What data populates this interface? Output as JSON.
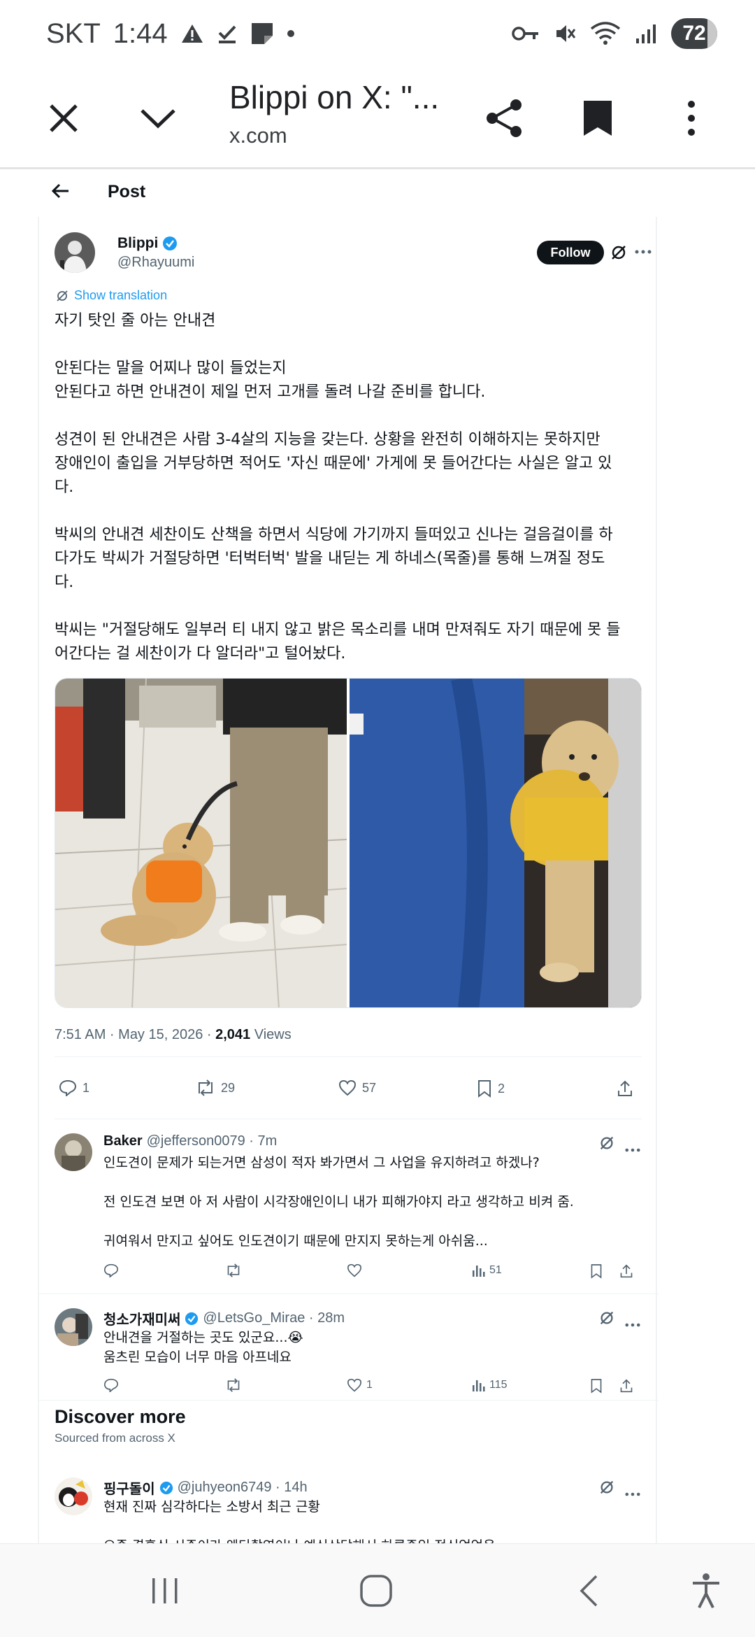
{
  "status_bar": {
    "carrier": "SKT",
    "time": "1:44",
    "battery": "72"
  },
  "tab_header": {
    "title": "Blippi on X: \"...",
    "url": "x.com"
  },
  "post_nav": {
    "title": "Post"
  },
  "post": {
    "author_name": "Blippi",
    "author_handle": "@Rhayuumi",
    "follow_label": "Follow",
    "translate_label": "Show translation",
    "paragraphs": {
      "p1": "자기 탓인 줄 아는 안내견",
      "p2a": "안된다는 말을 어찌나 많이 들었는지",
      "p2b": "안된다고 하면 안내견이 제일 먼저 고개를 돌려 나갈 준비를 합니다.",
      "p3a": "성견이 된 안내견은 사람 3-4살의 지능을 갖는다. 상황을 완전히 이해하지는 못하지만",
      "p3b": "장애인이 출입을 거부당하면 적어도 '자신 때문에' 가게에 못 들어간다는 사실은 알고 있",
      "p3c": "다.",
      "p4a": "박씨의 안내견 세찬이도 산책을 하면서 식당에 가기까지 들떠있고 신나는 걸음걸이를 하",
      "p4b": "다가도 박씨가 거절당하면 '터벅터벅' 발을 내딛는 게 하네스(목줄)를 통해 느껴질 정도",
      "p4c": "다.",
      "p5a": "박씨는 \"거절당해도 일부러 티 내지 않고 밝은 목소리를 내며 만져줘도 자기 때문에 못 들",
      "p5b": "어간다는 걸 세찬이가 다 알더라\"고 털어놨다."
    },
    "time": "7:51 AM · May 15, 2026 · ",
    "views_count": "2,041",
    "views_label": " Views",
    "replies": "1",
    "reposts": "29",
    "likes": "57",
    "bookmarks": "2"
  },
  "replies": [
    {
      "name": "Baker",
      "handle": "@jefferson0079 · 7m",
      "line1": "인도견이 문제가 되는거면 삼성이 적자 봐가면서 그 사업을 유지하려고 하겠나?",
      "line2": "전 인도견 보면 아 저 사람이 시각장애인이니 내가 피해가야지 라고 생각하고 비켜 줌.",
      "line3": "귀여워서 만지고 싶어도 인도견이기 때문에 만지지 못하는게 아쉬움...",
      "views": "51",
      "likes": ""
    },
    {
      "name": "청소가재미써",
      "handle": "@LetsGo_Mirae · 28m",
      "line1": "안내견을 거절하는 곳도 있군요...😭",
      "line2": "움츠린 모습이 너무 마음 아프네요",
      "views": "115",
      "likes": "1"
    }
  ],
  "discover": {
    "title": "Discover more",
    "subtitle": "Sourced from across X",
    "item_name": "핑구돌이",
    "item_handle": "@juhyeon6749 · 14h",
    "item_line1": "현재 진짜 심각하다는 소방서 최근 근황",
    "item_line2": "요즘 결혼식 시즌이라 웨딩촬영이나 예식상담해서 하루종일 정신없었음"
  },
  "colors": {
    "accent": "#1d9bf0",
    "text": "#0f1419",
    "muted": "#536471",
    "follow_bg": "#0f1419"
  }
}
